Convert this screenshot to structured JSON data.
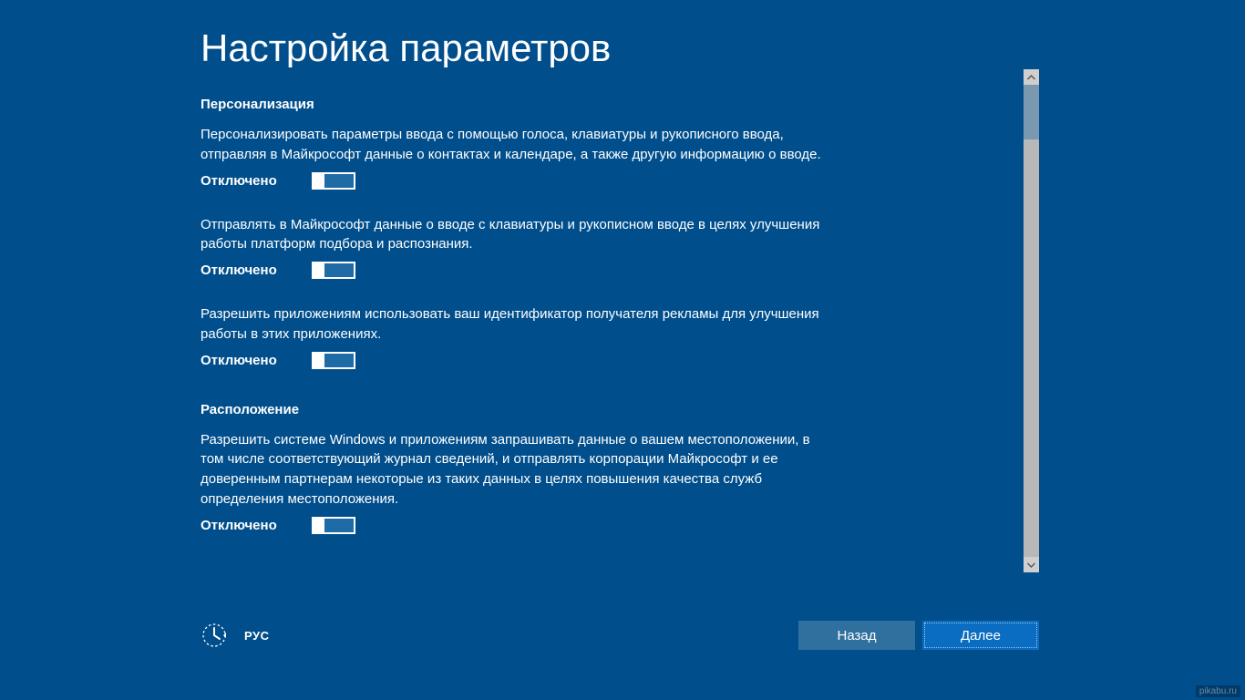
{
  "page": {
    "title": "Настройка параметров"
  },
  "sections": {
    "personalization": {
      "heading": "Персонализация",
      "settings": [
        {
          "description": "Персонализировать параметры ввода с помощью голоса, клавиатуры и рукописного ввода, отправляя в Майкрософт данные о контактах и календаре, а также другую информацию о вводе.",
          "state_label": "Отключено",
          "state": "off"
        },
        {
          "description": "Отправлять в Майкрософт данные о вводе с клавиатуры и рукописном вводе в целях улучшения работы платформ подбора и распознания.",
          "state_label": "Отключено",
          "state": "off"
        },
        {
          "description": "Разрешить приложениям использовать ваш идентификатор получателя рекламы для улучшения работы в этих приложениях.",
          "state_label": "Отключено",
          "state": "off"
        }
      ]
    },
    "location": {
      "heading": "Расположение",
      "settings": [
        {
          "description": "Разрешить системе Windows и приложениям запрашивать данные о вашем местоположении, в том числе соответствующий журнал сведений, и отправлять корпорации Майкрософт и ее доверенным партнерам некоторые из таких данных в целях повышения качества служб определения местоположения.",
          "state_label": "Отключено",
          "state": "off"
        }
      ]
    }
  },
  "footer": {
    "language": "РУС",
    "back_label": "Назад",
    "next_label": "Далее"
  },
  "watermark": "pikabu.ru"
}
